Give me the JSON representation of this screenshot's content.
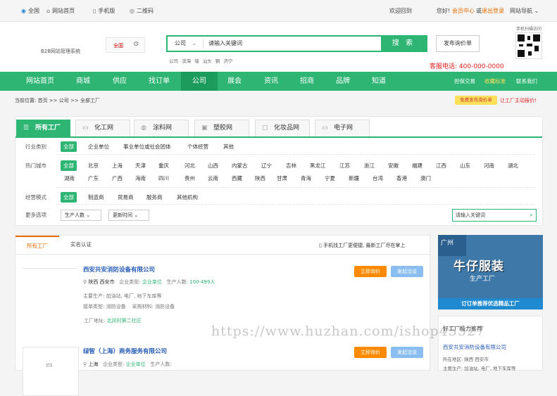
{
  "topbar": {
    "location": "全国",
    "home": "网站首页",
    "mobile": "手机版",
    "qrcode": "二维码",
    "welcome": "欢迎回到",
    "hello": "您好!",
    "member": "会员中心",
    "or": "或",
    "logout": "退出登录",
    "sitenav": "网站导航"
  },
  "header": {
    "logo": "B2B网站管理系统",
    "city": "全国",
    "search_type": "公司",
    "search_placeholder": "请输入关键词",
    "search_btn": "搜 索",
    "hot_words": "公司  滨海  墙  汕头  钢  济宁",
    "publish_btn": "发布询价单",
    "qr_label": "手机扫描访问",
    "hotline": "客服电话: 400-000-0000"
  },
  "nav": {
    "items": [
      "网站首页",
      "商城",
      "供应",
      "找订单",
      "公司",
      "展会",
      "资讯",
      "招商",
      "品牌",
      "知道"
    ],
    "right": [
      "担保交易",
      "收藏标准",
      "联系我们"
    ]
  },
  "crumb": {
    "text": "当前位置: 首页  >>  公司  >>  全部工厂",
    "free_btn": "免费发布询价单",
    "free_link": "让工厂主动报价!"
  },
  "category_tabs": [
    "所有工厂",
    "化工网",
    "涂料网",
    "塑胶网",
    "化妆品网",
    "电子网"
  ],
  "filters": {
    "industry_label": "行业类别",
    "industry": [
      "全部",
      "企业单位",
      "事业单位或社会团体",
      "个体经营",
      "其他"
    ],
    "city_label": "热门城市",
    "cities_row1": [
      "全部",
      "北京",
      "上海",
      "天津",
      "重庆",
      "河北",
      "山西",
      "内蒙古",
      "辽宁",
      "吉林",
      "黑龙江",
      "江苏",
      "浙江",
      "安徽",
      "福建",
      "江西",
      "山东",
      "河南",
      "湖北"
    ],
    "cities_row2": [
      "湖南",
      "广东",
      "广西",
      "海南",
      "四川",
      "贵州",
      "云南",
      "西藏",
      "陕西",
      "甘肃",
      "青海",
      "宁夏",
      "新疆",
      "台湾",
      "香港",
      "澳门"
    ],
    "mode_label": "经营模式",
    "modes": [
      "全部",
      "制造商",
      "贸易商",
      "服务商",
      "其他机构"
    ],
    "more_label": "更多选项",
    "dd1": "生产人数",
    "dd2": "更新时间",
    "keyword_placeholder": "请输入关键词"
  },
  "list": {
    "tabs": [
      "所有工厂",
      "实名认证"
    ],
    "note": "手机找工厂更便捷, 最新工厂尽在掌上",
    "companies": [
      {
        "name": "西安共安消防设备有限公司",
        "location": "陕西 西安市",
        "type_label": "企业类型:",
        "type": "企业单位",
        "size_label": "生产人数:",
        "size": "100-499人",
        "main": "主要生产: 加油站, 电厂, 地下车库等",
        "order_type": "接单类型: 消防设备",
        "material": "采购材料: 消防设备",
        "address_label": "工厂地址:",
        "address": "北凤村第二社区",
        "btn_inquiry": "立即询价",
        "btn_chat": "发起洽谈"
      },
      {
        "name": "绿智（上海）商务服务有限公司",
        "location": "上海",
        "type_label": "企业类型:",
        "type": "企业单位",
        "size_label": "生产人数:",
        "btn_inquiry": "立即询价",
        "btn_chat": "发起洽谈"
      }
    ]
  },
  "ad": {
    "tag": "广州",
    "title": "牛仔服装",
    "sub": "生产工厂",
    "footer": "订订单推荐优选精品工厂"
  },
  "side": {
    "heading": "好工厂极力推荐",
    "company": "西安共安消防设备有限公司",
    "loc": "所在地区: 陕西 西安市",
    "main": "主要生产: 加油站, 电厂, 地下车库等"
  },
  "watermark": "https://www.huzhan.com/ishop45527"
}
